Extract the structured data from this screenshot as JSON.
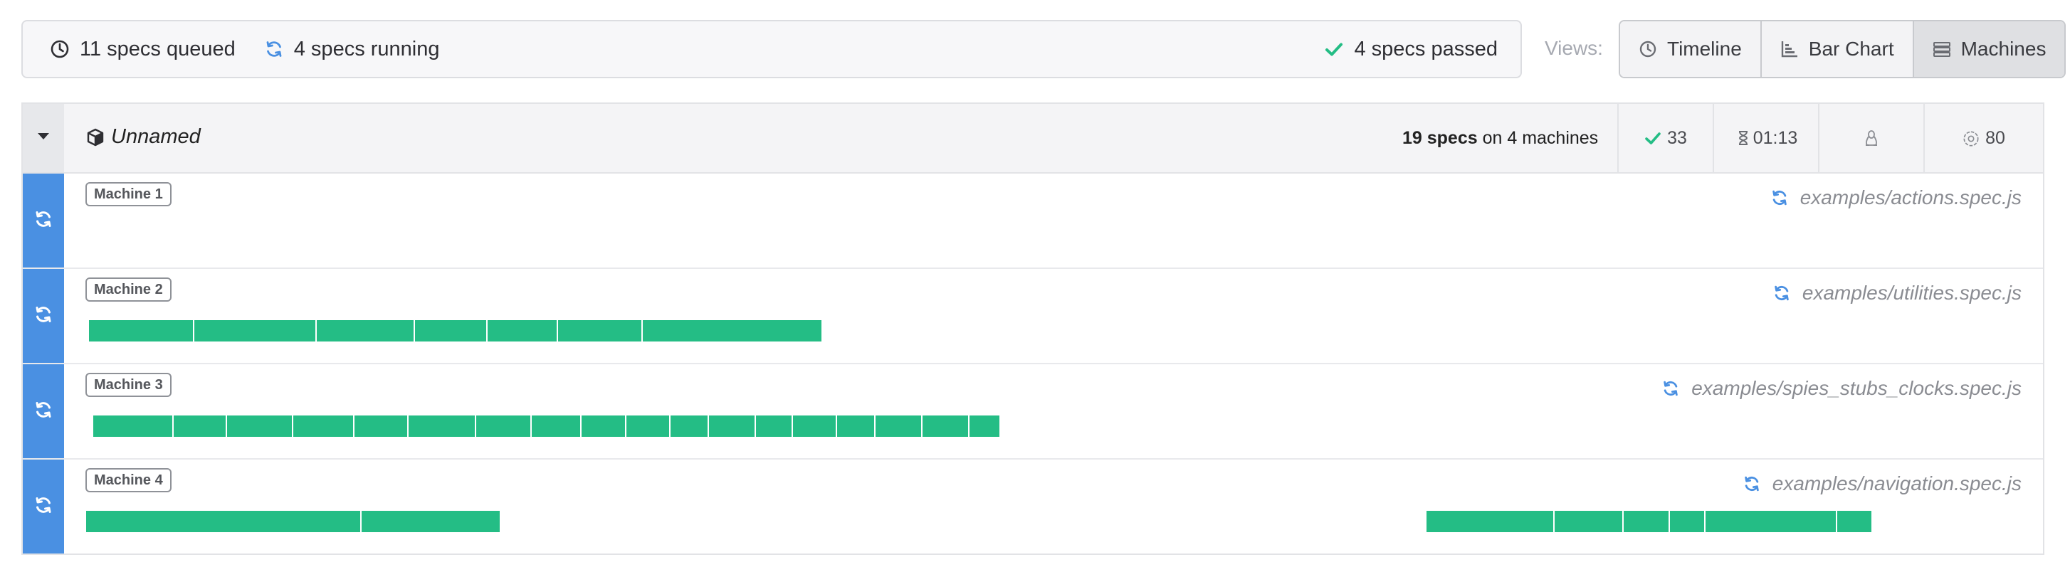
{
  "status": {
    "queued": "11 specs queued",
    "running": "4 specs running",
    "passed": "4 specs passed"
  },
  "views": {
    "label": "Views:",
    "buttons": [
      {
        "label": "Timeline",
        "icon": "clock-icon"
      },
      {
        "label": "Bar Chart",
        "icon": "bar-chart-icon"
      },
      {
        "label": "Machines",
        "icon": "machines-icon",
        "active": true
      }
    ]
  },
  "group": {
    "name": "Unnamed",
    "specs_count": "19 specs",
    "machines_text": " on 4 machines",
    "passed": "33",
    "duration": "01:13",
    "score": "80"
  },
  "machines": [
    {
      "label": "Machine 1",
      "spec": "examples/actions.spec.js"
    },
    {
      "label": "Machine 2",
      "spec": "examples/utilities.spec.js"
    },
    {
      "label": "Machine 3",
      "spec": "examples/spies_stubs_clocks.spec.js"
    },
    {
      "label": "Machine 4",
      "spec": "examples/navigation.spec.js"
    }
  ],
  "colors": {
    "passed": "#24bd85",
    "running": "#4a90e2",
    "muted": "#a6a9b1"
  }
}
